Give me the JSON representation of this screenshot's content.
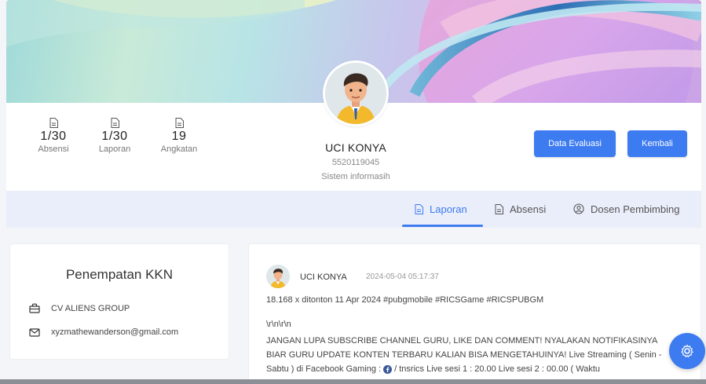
{
  "profile": {
    "name": "UCI KONYA",
    "id": "5520119045",
    "program": "Sistem informasih"
  },
  "stats": [
    {
      "value": "1/30",
      "label": "Absensi",
      "icon": "document-icon"
    },
    {
      "value": "1/30",
      "label": "Laporan",
      "icon": "document-icon"
    },
    {
      "value": "19",
      "label": "Angkatan",
      "icon": "document-icon"
    }
  ],
  "actions": {
    "evaluation_label": "Data Evaluasi",
    "back_label": "Kembali"
  },
  "tabs": [
    {
      "label": "Laporan",
      "icon": "document-icon",
      "active": true
    },
    {
      "label": "Absensi",
      "icon": "document-icon",
      "active": false
    },
    {
      "label": "Dosen Pembimbing",
      "icon": "user-circle-icon",
      "active": false
    }
  ],
  "placement": {
    "title": "Penempatan KKN",
    "company": "CV ALIENS GROUP",
    "email": "xyzmathewanderson@gmail.com"
  },
  "post": {
    "author": "UCI KONYA",
    "timestamp": "2024-05-04 05:17:37",
    "lines": [
      "18.168 x ditonton 11 Apr 2024 #pubgmobile #RICSGame #RICSPUBGM",
      "\\r\\n\\r\\n",
      "JANGAN LUPA SUBSCRIBE CHANNEL GURU, LIKE DAN COMMENT! NYALAKAN NOTIFIKASINYA",
      "BIAR GURU UPDATE KONTEN TERBARU KALIAN BISA MENGETAHUINYA! Live Streaming ( Senin -",
      "Sabtu ) di Facebook Gaming : ",
      "/ tnsrics  Live sesi 1 : 20.00 Live sesi 2 : 00.00 ( Waktu"
    ]
  },
  "colors": {
    "accent": "#3d7bf0",
    "tabbar_bg": "#eaeefa",
    "page_bg": "#f4f5f8"
  },
  "fab_icon": "settings-gear-icon"
}
